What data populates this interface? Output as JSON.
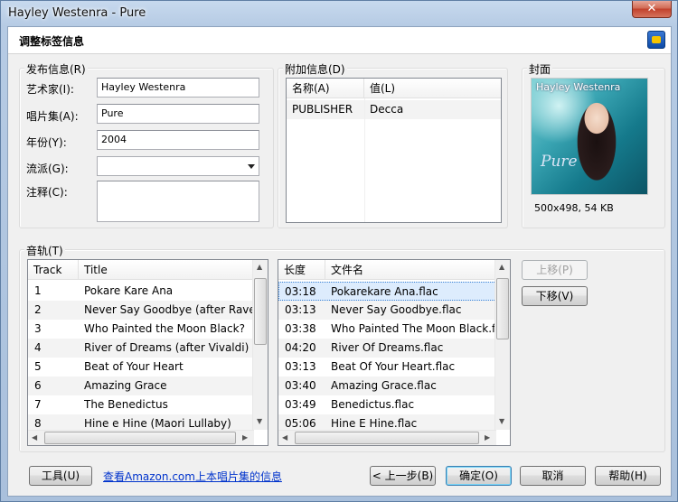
{
  "window": {
    "title": "Hayley Westenra - Pure",
    "close_label": "✕"
  },
  "header": {
    "title": "调整标签信息"
  },
  "publish": {
    "group_label": "发布信息(R)",
    "artist_label": "艺术家(I):",
    "artist_value": "Hayley Westenra",
    "album_label": "唱片集(A):",
    "album_value": "Pure",
    "year_label": "年份(Y):",
    "year_value": "2004",
    "genre_label": "流派(G):",
    "genre_value": "",
    "comment_label": "注释(C):",
    "comment_value": ""
  },
  "extra": {
    "group_label": "附加信息(D)",
    "columns": [
      "名称(A)",
      "值(L)"
    ],
    "rows": [
      {
        "name": "PUBLISHER",
        "value": "Decca"
      }
    ]
  },
  "cover": {
    "group_label": "封面",
    "artist_text": "Hayley Westenra",
    "album_text": "Pure",
    "info": "500x498, 54 KB"
  },
  "tracks": {
    "group_label": "音轨(T)",
    "columns": [
      "Track",
      "Title"
    ],
    "rows": [
      {
        "track": "1",
        "title": "Pokare Kare Ana"
      },
      {
        "track": "2",
        "title": "Never Say Goodbye (after Ravel"
      },
      {
        "track": "3",
        "title": "Who Painted the Moon Black?"
      },
      {
        "track": "4",
        "title": "River of Dreams (after Vivaldi)"
      },
      {
        "track": "5",
        "title": "Beat of Your Heart"
      },
      {
        "track": "6",
        "title": "Amazing Grace"
      },
      {
        "track": "7",
        "title": "The Benedictus"
      },
      {
        "track": "8",
        "title": "Hine e Hine (Maori Lullaby)"
      }
    ]
  },
  "files": {
    "columns": [
      "长度",
      "文件名"
    ],
    "rows": [
      {
        "length": "03:18",
        "name": "Pokarekare Ana.flac"
      },
      {
        "length": "03:13",
        "name": "Never Say Goodbye.flac"
      },
      {
        "length": "03:38",
        "name": "Who Painted The Moon Black.f"
      },
      {
        "length": "04:20",
        "name": "River Of Dreams.flac"
      },
      {
        "length": "03:13",
        "name": "Beat Of Your Heart.flac"
      },
      {
        "length": "03:40",
        "name": "Amazing Grace.flac"
      },
      {
        "length": "03:49",
        "name": "Benedictus.flac"
      },
      {
        "length": "05:06",
        "name": "Hine E Hine.flac"
      }
    ]
  },
  "move": {
    "up_label": "上移(P)",
    "down_label": "下移(V)"
  },
  "footer": {
    "tools_label": "工具(U)",
    "amazon_link": "查看Amazon.com上本唱片集的信息",
    "back_label": "< 上一步(B)",
    "ok_label": "确定(O)",
    "cancel_label": "取消",
    "help_label": "帮助(H)"
  },
  "colors": {
    "selection": "#ddecfd",
    "link": "#0033cc",
    "close": "#c2412c"
  }
}
